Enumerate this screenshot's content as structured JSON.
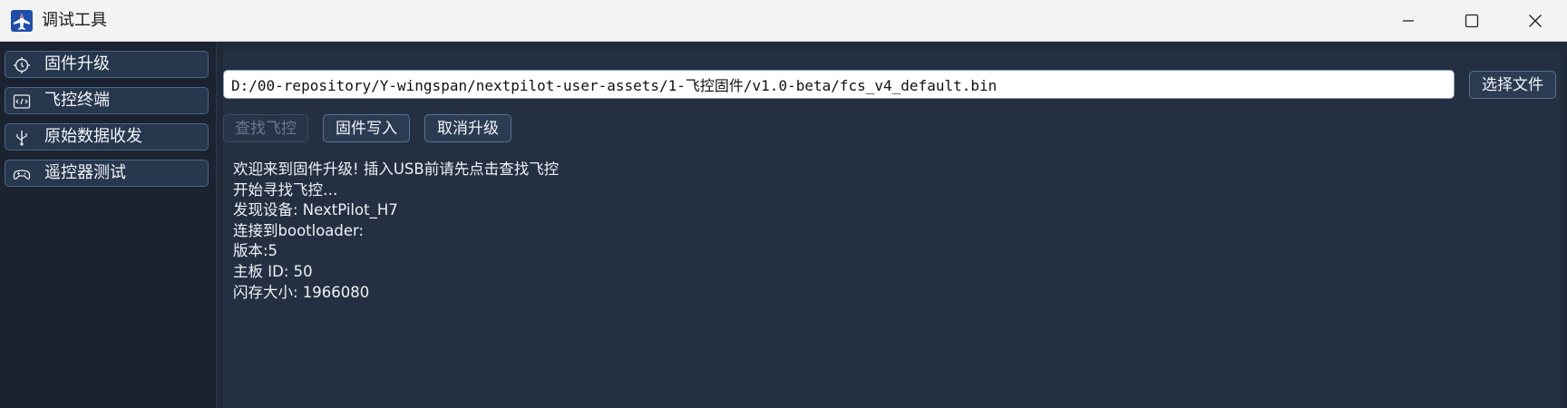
{
  "window": {
    "title": "调试工具",
    "icon": "paper-plane-icon",
    "controls": [
      "minimize-icon",
      "maximize-icon",
      "close-icon"
    ]
  },
  "sidebar": {
    "items": [
      {
        "label": "固件升级",
        "icon": "firmware-chip-icon"
      },
      {
        "label": "飞控终端",
        "icon": "terminal-code-icon"
      },
      {
        "label": "原始数据收发",
        "icon": "usb-icon"
      },
      {
        "label": "遥控器测试",
        "icon": "gamepad-icon"
      }
    ]
  },
  "main": {
    "file_path": "D:/00-repository/Y-wingspan/nextpilot-user-assets/1-飞控固件/v1.0-beta/fcs_v4_default.bin",
    "select_file_label": "选择文件",
    "find_label": "查找飞控",
    "write_label": "固件写入",
    "cancel_label": "取消升级",
    "log_lines": [
      "欢迎来到固件升级! 插入USB前请先点击查找飞控",
      "开始寻找飞控…",
      "发现设备: NextPilot_H7",
      "连接到bootloader:",
      "版本:5",
      "主板 ID: 50",
      "闪存大小: 1966080"
    ]
  },
  "colors": {
    "background": "#1f2937",
    "panel": "#243041",
    "button_border": "#5b7396",
    "titlebar": "#f3f3f3"
  }
}
